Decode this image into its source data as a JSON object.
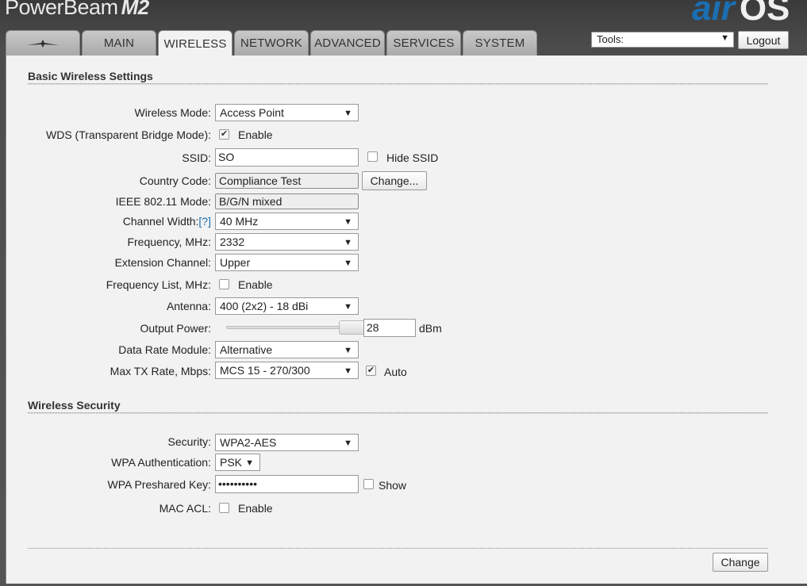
{
  "header": {
    "brand": "PowerBeam",
    "brand_model": "M2",
    "logo_air": "air",
    "logo_os": "OS"
  },
  "tabs": [
    {
      "label": "",
      "icon": "ubiquiti-logo-icon"
    },
    {
      "label": "MAIN"
    },
    {
      "label": "WIRELESS",
      "active": true
    },
    {
      "label": "NETWORK"
    },
    {
      "label": "ADVANCED"
    },
    {
      "label": "SERVICES"
    },
    {
      "label": "SYSTEM"
    }
  ],
  "tools": {
    "label": "Tools:",
    "logout": "Logout"
  },
  "basic": {
    "title": "Basic Wireless Settings",
    "wireless_mode": {
      "label": "Wireless Mode:",
      "value": "Access Point"
    },
    "wds": {
      "label": "WDS (Transparent Bridge Mode):",
      "checked": true,
      "option": "Enable"
    },
    "ssid": {
      "label": "SSID:",
      "value": "SO",
      "hide_label": "Hide SSID",
      "hide_checked": false
    },
    "country": {
      "label": "Country Code:",
      "value": "Compliance Test",
      "change": "Change..."
    },
    "ieee": {
      "label": "IEEE 802.11 Mode:",
      "value": "B/G/N mixed"
    },
    "channel_width": {
      "label": "Channel Width:",
      "help": "[?]",
      "value": "40 MHz"
    },
    "frequency": {
      "label": "Frequency, MHz:",
      "value": "2332"
    },
    "extension": {
      "label": "Extension Channel:",
      "value": "Upper"
    },
    "freq_list": {
      "label": "Frequency List, MHz:",
      "checked": false,
      "option": "Enable"
    },
    "antenna": {
      "label": "Antenna:",
      "value": "400 (2x2) - 18 dBi"
    },
    "output_power": {
      "label": "Output Power:",
      "value": "28",
      "unit": "dBm",
      "level": 1.0
    },
    "data_rate": {
      "label": "Data Rate Module:",
      "value": "Alternative"
    },
    "max_tx": {
      "label": "Max TX Rate, Mbps:",
      "value": "MCS 15 - 270/300",
      "auto_label": "Auto",
      "auto_checked": true
    }
  },
  "security": {
    "title": "Wireless Security",
    "security": {
      "label": "Security:",
      "value": "WPA2-AES"
    },
    "wpa_auth": {
      "label": "WPA Authentication:",
      "value": "PSK"
    },
    "psk": {
      "label": "WPA Preshared Key:",
      "value": "••••••••••",
      "show_label": "Show",
      "show_checked": false
    },
    "mac_acl": {
      "label": "MAC ACL:",
      "checked": false,
      "option": "Enable"
    }
  },
  "footer": {
    "change": "Change"
  }
}
